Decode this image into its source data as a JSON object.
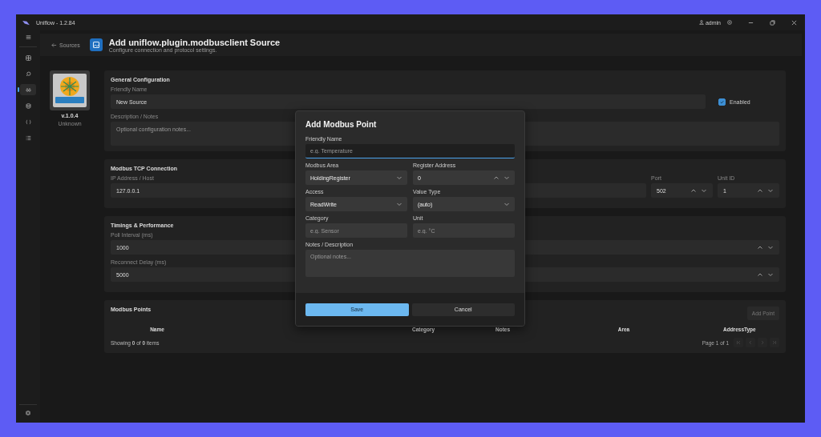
{
  "window": {
    "title": "Uniflow - 1.2.84",
    "user": "admin"
  },
  "sidebar": {
    "items": [
      {
        "selected": false
      },
      {
        "selected": false
      },
      {
        "selected": true
      },
      {
        "selected": false
      },
      {
        "selected": false
      },
      {
        "selected": false
      }
    ]
  },
  "header": {
    "back_label": "Sources",
    "title": "Add uniflow.plugin.modbusclient Source",
    "subtitle": "Configure connection and protocol settings."
  },
  "plugin": {
    "version": "v.1.0.4",
    "status": "Unknown"
  },
  "general": {
    "title": "General Configuration",
    "friendly_name": {
      "label": "Friendly Name",
      "value": "New Source"
    },
    "enabled": {
      "label": "Enabled",
      "checked": true
    },
    "description": {
      "label": "Description / Notes",
      "placeholder": "Optional configuration notes..."
    }
  },
  "connection": {
    "title": "Modbus TCP Connection",
    "host": {
      "label": "IP Address / Host",
      "value": "127.0.0.1"
    },
    "port": {
      "label": "Port",
      "value": "502"
    },
    "unit_id": {
      "label": "Unit ID",
      "value": "1"
    }
  },
  "timings": {
    "title": "Timings & Performance",
    "fields": [
      {
        "label": "Poll Interval (ms)",
        "value": "1000"
      },
      {
        "label": "Reconnect Delay (ms)",
        "value": "5000"
      }
    ]
  },
  "points": {
    "title": "Modbus Points",
    "add_button": {
      "label": "Add Point",
      "disabled": true
    },
    "columns": [
      "Name",
      "Category",
      "Notes",
      "Area",
      "Address",
      "Type"
    ],
    "summary": "Showing **0** of **0** items",
    "page_label": "Page 1 of 1",
    "pager_disabled": true
  },
  "dialog": {
    "title": "Add Modbus Point",
    "fields": [
      {
        "kind": "name",
        "label": "Friendly Name",
        "placeholder": "e.g. Temperature",
        "focused": true
      },
      {
        "kind": "select",
        "label": "Modbus Area",
        "value": "HoldingRegister",
        "focused": false
      },
      {
        "kind": "spin",
        "label": "Register Address",
        "value": "0",
        "focused": false
      },
      {
        "kind": "select",
        "label": "Access",
        "value": "ReadWrite",
        "focused": false
      },
      {
        "kind": "select",
        "label": "Value Type",
        "value": "(auto)",
        "focused": false
      },
      {
        "kind": "text",
        "label": "Category",
        "placeholder": "e.g. Sensor",
        "focused": false
      },
      {
        "kind": "text",
        "label": "Unit",
        "placeholder": "e.g. °C",
        "focused": false
      },
      {
        "kind": "textarea",
        "label": "Notes / Description",
        "placeholder": "Optional notes...",
        "focused": false
      }
    ],
    "buttons": [
      {
        "kind": "primary",
        "label": "Save"
      },
      {
        "kind": "secondary",
        "label": "Cancel"
      }
    ]
  }
}
